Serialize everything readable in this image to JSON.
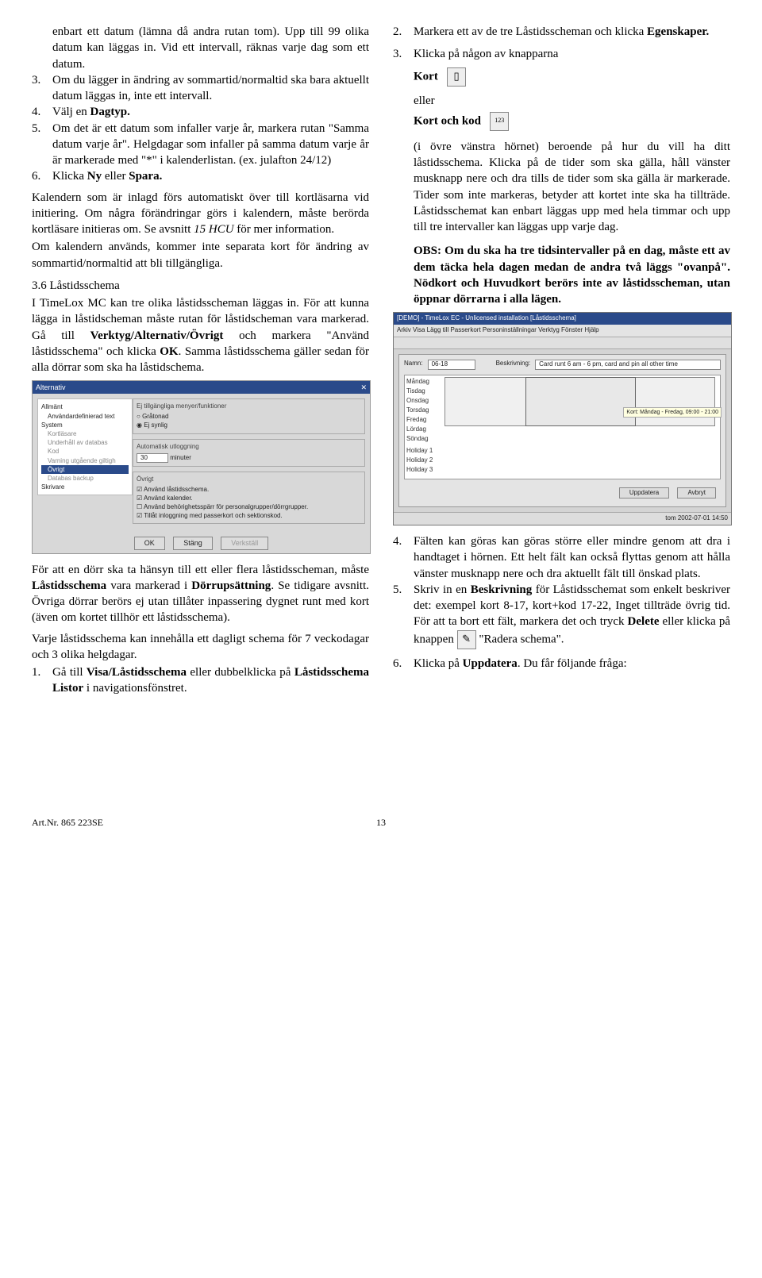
{
  "left": {
    "p1": "enbart ett datum (lämna då andra rutan tom). Upp till 99 olika datum kan läggas in. Vid ett intervall, räknas varje dag som ett datum.",
    "li3_a": "Om du lägger in ändring av sommartid/normaltid ska bara aktuellt datum läggas in, inte ett intervall.",
    "li4": "Välj en ",
    "li4_b": "Dagtyp.",
    "li5": "Om det är ett datum som infaller varje år, markera rutan \"Samma datum varje år\". Helgdagar som infaller på samma datum varje år är markerade med \"*\" i kalenderlistan. (ex. julafton 24/12)",
    "li6_a": "Klicka ",
    "li6_b": "Ny",
    "li6_c": " eller ",
    "li6_d": "Spara.",
    "p2_a": "Kalendern som är inlagd förs automatiskt över till kortläsarna vid initiering. Om några förändringar görs i kalendern, måste berörda kortläsare initieras om. Se avsnitt ",
    "p2_i": "15 HCU",
    "p2_b": " för mer information.",
    "p3": "Om kalendern används, kommer inte separata kort för ändring av sommartid/normaltid att bli tillgängliga.",
    "h36": "3.6 Låstidsschema",
    "p4_a": "I TimeLox MC kan tre olika låstidsscheman läggas in. För att kunna lägga in låstidscheman måste rutan för låstidscheman vara markerad. Gå till ",
    "p4_b": "Verktyg/Alternativ/Övrigt",
    "p4_c": " och markera \"Använd låstidsschema\" och klicka ",
    "p4_d": "OK",
    "p4_e": ". Samma låstidsschema gäller sedan för alla dörrar som ska ha låstidschema.",
    "p5_a": "För att en dörr ska ta hänsyn till ett eller flera låstidsscheman, måste ",
    "p5_b": "Låstidsschema",
    "p5_c": " vara markerad i ",
    "p5_d": "Dörrupsättning",
    "p5_e": ". Se tidigare avsnitt. Övriga dörrar berörs ej utan tillåter inpassering dygnet runt med kort (även om kortet tillhör ett låstidsschema).",
    "p6": "Varje låstidsschema kan innehålla ett dagligt schema för 7 veckodagar och 3 olika helgdagar.",
    "li1b_a": "Gå till ",
    "li1b_b": "Visa/Låstidsschema",
    "li1b_c": " eller dubbelklicka på ",
    "li1b_d": "Låstidsschema Listor",
    "li1b_e": " i navigationsfönstret."
  },
  "right": {
    "li2_a": "Markera ett av de tre Låstidsscheman och klicka ",
    "li2_b": "Egenskaper.",
    "li3": "Klicka på någon av knapparna",
    "kort": "Kort",
    "eller": "eller",
    "kortkod": "Kort och kod",
    "p7": "(i övre vänstra hörnet) beroende på hur du vill ha ditt låstidsschema. Klicka på de tider som ska gälla, håll vänster musknapp nere och dra tills de tider som ska gälla är markerade. Tider som inte markeras, betyder att kortet inte ska ha tillträde. Låstidsschemat kan enbart läggas upp med hela timmar och upp till tre intervaller kan läggas upp varje dag.",
    "p8_a": "OBS: Om du ska ha tre tidsintervaller på en dag, måste ett av dem täcka hela dagen medan de andra två läggs \"ovanpå\". Nödkort och Huvudkort berörs inte av låstidsscheman, utan öppnar dörrarna i alla lägen.",
    "li4": "Fälten kan göras kan göras större eller mindre genom att dra i handtaget i hörnen. Ett helt fält kan också flyttas genom att hålla vänster musknapp nere och dra aktuellt fält till önskad plats.",
    "li5_a": "Skriv in en ",
    "li5_b": "Beskrivning",
    "li5_c": " för Låstidsschemat som enkelt beskriver det: exempel kort 8-17, kort+kod 17-22, Inget tillträde övrig tid. För att ta bort ett fält, markera det och tryck ",
    "li5_d": "Delete",
    "li5_e": " eller klicka på knappen ",
    "li5_f": " \"Radera schema\".",
    "li6_a": "Klicka på ",
    "li6_b": "Uppdatera",
    "li6_c": ". Du får följande fråga:"
  },
  "ss1": {
    "title": "Alternativ",
    "tree": [
      "Allmänt",
      "Användardefinierad text",
      "System",
      "Kortläsare",
      "Underhåll av databas",
      "Kod",
      "Varning utgående giltigh",
      "Övrigt",
      "Databas backup",
      "Skrivare"
    ],
    "group1": "Ej tillgängliga menyer/funktioner",
    "r1": "Gråtonad",
    "r2": "Ej synlig",
    "group2": "Automatisk utloggning",
    "min_val": "30",
    "min_lbl": "minuter",
    "group3": "Övrigt",
    "c1": "Använd låstidsschema.",
    "c2": "Använd kalender.",
    "c3": "Använd behörighetsspärr för personalgrupper/dörrgrupper.",
    "c4": "Tillåt inloggning med passerkort och sektionskod.",
    "ok": "OK",
    "stang": "Stäng",
    "verkstall": "Verkställ"
  },
  "ss2": {
    "title": "[DEMO] - TimeLox EC - Unlicensed installation  [Låstidsschema]",
    "menu": "Arkiv  Visa  Lägg till  Passerkort  Personinställningar  Verktyg  Fönster  Hjälp",
    "namn_lbl": "Namn:",
    "namn_val": "06-18",
    "beskr_lbl": "Beskrivning:",
    "beskr_val": "Card runt 6 am - 6 pm, card and pin all other time",
    "days": [
      "Måndag",
      "Tisdag",
      "Onsdag",
      "Torsdag",
      "Fredag",
      "Lördag",
      "Söndag",
      "Holiday 1",
      "Holiday 2",
      "Holiday 3"
    ],
    "tip": "Kort: Måndag - Fredag, 09:00 - 21:00",
    "uppdatera": "Uppdatera",
    "avbryt": "Avbryt",
    "status": "tom            2002-07-01    14:50"
  },
  "icon2": "123",
  "footer_art": "Art.Nr. 865 223SE",
  "page": "13"
}
